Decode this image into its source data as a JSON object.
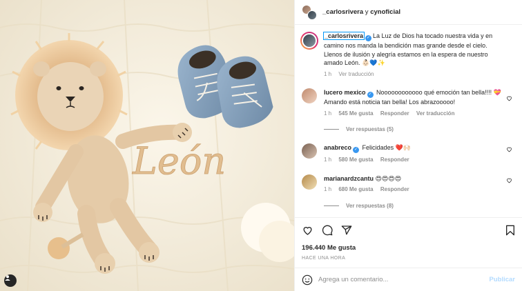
{
  "header": {
    "user1": "_carlosrivera",
    "joiner": " y ",
    "user2": "cynoficial"
  },
  "caption": {
    "username": "_carlosrivera",
    "text": "La Luz de Dios ha tocado nuestra vida y en camino nos manda la bendición mas grande desde el cielo. Llenos de ilusión y alegría estamos en la espera de nuestro amado León. 👶🏻💙✨",
    "time": "1 h",
    "translate": "Ver traducción"
  },
  "comments": [
    {
      "username": "lucero mexico",
      "text": "Noooooooooooo qué emoción tan bella!!!! 💝 Amando está noticia tan bella! Los abrazooooo!",
      "time": "1 h",
      "likes": "545 Me gusta",
      "reply": "Responder",
      "translate": "Ver traducción",
      "replies": "Ver respuestas (5)"
    },
    {
      "username": "anabreco",
      "text": "Felicidades ❤️🙌🏻",
      "time": "1 h",
      "likes": "580 Me gusta",
      "reply": "Responder"
    },
    {
      "username": "marianardzcantu",
      "text": "😍😍😍😍",
      "time": "1 h",
      "likes": "680 Me gusta",
      "reply": "Responder",
      "replies": "Ver respuestas (8)"
    }
  ],
  "post": {
    "likes": "196.440 Me gusta",
    "posted": "HACE UNA HORA"
  },
  "composer": {
    "placeholder": "Agrega un comentario...",
    "publish": "Publicar"
  },
  "photo": {
    "embroidery": "León"
  },
  "colors": {
    "accent": "#0095f6",
    "publish_disabled": "#b3dbff",
    "secondary_text": "#8e8e8e",
    "heart_red": "#ed4956"
  },
  "icons": [
    "user-tag-icon",
    "heart-icon",
    "comment-icon",
    "share-icon",
    "bookmark-icon",
    "emoji-icon",
    "verified-icon"
  ]
}
